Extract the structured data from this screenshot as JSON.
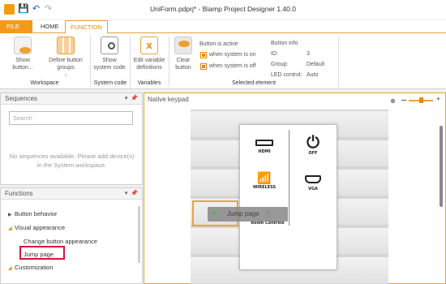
{
  "window": {
    "title": "UniForm.pdprj* - Biamp Project Designer 1.40.0"
  },
  "tabs": {
    "file": "FILE",
    "home": "HOME",
    "function": "FUNCTION"
  },
  "ribbon": {
    "show_button": [
      "Show",
      "button..."
    ],
    "define_button_groups": [
      "Define button",
      "groups"
    ],
    "show_system_code": [
      "Show",
      "system code"
    ],
    "edit_variable_definitions": [
      "Edit variable",
      "definitions"
    ],
    "clear_button": [
      "Clear",
      "button"
    ],
    "groups": {
      "workspace": "Workspace",
      "system_code": "System code",
      "variables": "Variables",
      "selected_element": "Selected element"
    },
    "button_active_title": "Button is active",
    "when_on": "when system is on",
    "when_off": "when system is off",
    "button_info": {
      "title": "Button info",
      "id_label": "ID:",
      "id_value": "3",
      "group_label": "Group:",
      "group_value": "Default",
      "led_label": "LED control:",
      "led_value": "Auto"
    }
  },
  "sequences": {
    "title": "Sequences",
    "search_placeholder": "Search",
    "empty_message": "No sequences available. Please add device(s) in the System workspace."
  },
  "functions": {
    "title": "Functions",
    "items": [
      "Button behavior",
      "Visual appearance",
      "Change button appearance",
      "Jump page",
      "Customization"
    ]
  },
  "canvas": {
    "title": "Native keypad",
    "lcd": {
      "hdmi": "HDMI",
      "off": "OFF",
      "wireless": "WIRELESS",
      "vga": "VGA",
      "room_controls": "Room Controls"
    },
    "drag_label": "Jump page"
  },
  "colors": {
    "accent": "#f39a1c",
    "highlight": "#d9143a",
    "check": "#2eab3d"
  }
}
